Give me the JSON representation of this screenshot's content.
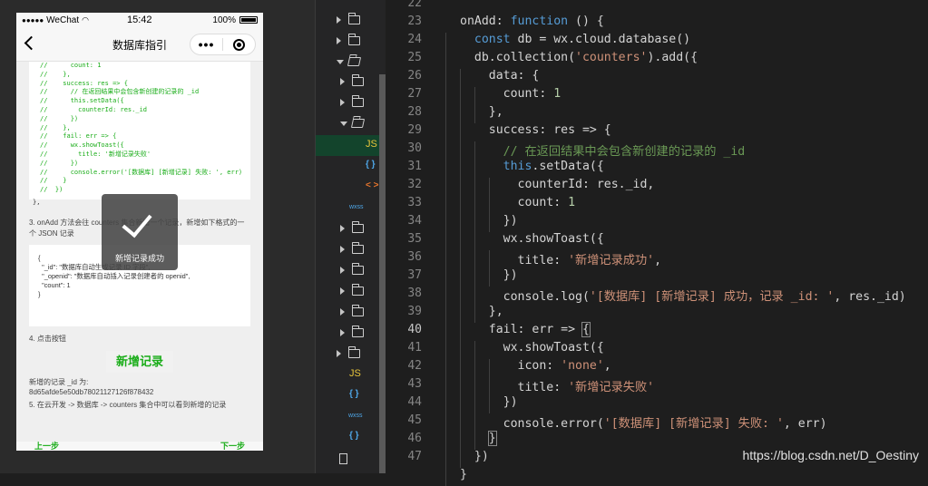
{
  "phone": {
    "status": {
      "carrier": "WeChat",
      "signal_dots": "●●●●●",
      "time": "15:42",
      "battery": "100%"
    },
    "nav": {
      "title": "数据库指引",
      "more": "•••"
    },
    "code_snippet": "//      count: 1\n//    },\n//    success: res => {\n//      // 在返回结果中会包含新创建的记录的 _id\n//      this.setData({\n//        counterId: res._id\n//      })\n//    },\n//    fail: err => {\n//      wx.showToast({\n//        title: '新增记录失败'\n//      })\n//      console.error('[数据库] [新增记录] 失败: ', err)\n//    }\n//  })",
    "code_tail": "},",
    "step3": "3. onAdd 方法会往 counters 集合新增一个记录，新增如下格式的一个 JSON 记录",
    "json_record": "{\n  \"_id\": \"数据库自动生成记录 ID 字段\",\n  \"_openid\": \"数据库自动插入记录创建者的 openid\",\n  \"count\": 1\n}",
    "step4": "4. 点击按钮",
    "add_button": "新增记录",
    "result_label": "新增的记录 _id 为:",
    "result_id": "8d65afde5e50db78021127126f878432",
    "step5": "5. 在云开发 -> 数据库 -> counters 集合中可以看到新增的记录",
    "toast": "新增记录成功",
    "bottom_left": "上一步",
    "bottom_right": "下一步"
  },
  "tree": {
    "items": [
      {
        "kind": "folder",
        "state": "collapsed",
        "indent": 0
      },
      {
        "kind": "folder",
        "state": "collapsed",
        "indent": 0
      },
      {
        "kind": "folder",
        "state": "expanded",
        "indent": 0
      },
      {
        "kind": "folder",
        "state": "collapsed",
        "indent": 1
      },
      {
        "kind": "folder",
        "state": "collapsed",
        "indent": 1
      },
      {
        "kind": "folder",
        "state": "expanded",
        "indent": 1
      },
      {
        "kind": "file",
        "label": "JS",
        "type": "js",
        "selected": true
      },
      {
        "kind": "file",
        "label": "{ }",
        "type": "json"
      },
      {
        "kind": "file",
        "label": "< >",
        "type": "wxml"
      },
      {
        "kind": "file",
        "label": "wxss",
        "type": "wxss"
      },
      {
        "kind": "folder",
        "state": "collapsed",
        "indent": 1
      },
      {
        "kind": "folder",
        "state": "collapsed",
        "indent": 1
      },
      {
        "kind": "folder",
        "state": "collapsed",
        "indent": 1
      },
      {
        "kind": "folder",
        "state": "collapsed",
        "indent": 1
      },
      {
        "kind": "folder",
        "state": "collapsed",
        "indent": 1
      },
      {
        "kind": "folder",
        "state": "collapsed",
        "indent": 1
      },
      {
        "kind": "folder",
        "state": "collapsed",
        "indent": 0
      },
      {
        "kind": "file",
        "label": "JS",
        "type": "js"
      },
      {
        "kind": "file",
        "label": "{ }",
        "type": "json"
      },
      {
        "kind": "file",
        "label": "wxss",
        "type": "wxss"
      },
      {
        "kind": "file",
        "label": "{ }",
        "type": "json"
      },
      {
        "kind": "file",
        "label": "",
        "type": "doc"
      }
    ]
  },
  "editor": {
    "active_line": "40",
    "line_numbers": [
      "22",
      "23",
      "24",
      "25",
      "26",
      "27",
      "28",
      "29",
      "30",
      "31",
      "32",
      "33",
      "34",
      "35",
      "36",
      "37",
      "38",
      "39",
      "40",
      "41",
      "42",
      "43",
      "44",
      "45",
      "46",
      "47"
    ],
    "lines": [
      "",
      "onAdd: function () {",
      "  const db = wx.cloud.database()",
      "  db.collection('counters').add({",
      "    data: {",
      "      count: 1",
      "    },",
      "    success: res => {",
      "      // 在返回结果中会包含新创建的记录的 _id",
      "      this.setData({",
      "        counterId: res._id,",
      "        count: 1",
      "      })",
      "      wx.showToast({",
      "        title: '新增记录成功',",
      "      })",
      "      console.log('[数据库] [新增记录] 成功，记录 _id: ', res._id)",
      "    },",
      "    fail: err => {",
      "      wx.showToast({",
      "        icon: 'none',",
      "        title: '新增记录失败'",
      "      })",
      "      console.error('[数据库] [新增记录] 失败: ', err)",
      "    }",
      "  })",
      "}"
    ]
  },
  "watermark": "https://blog.csdn.net/D_Oestiny",
  "colors": {
    "keyword": "#569cd6",
    "string": "#ce9178",
    "number": "#b5cea8",
    "comment": "#6a9955",
    "wechat_green": "#1aad19"
  }
}
